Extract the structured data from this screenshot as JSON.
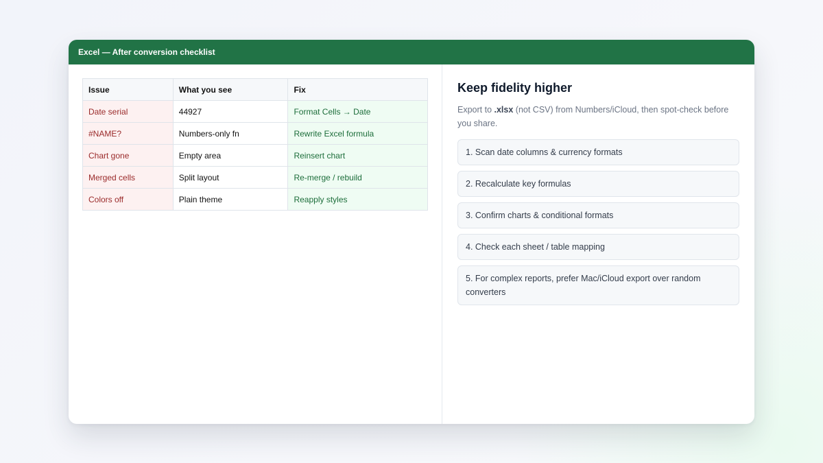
{
  "window": {
    "title": "Excel — After conversion checklist"
  },
  "table": {
    "headers": [
      "Issue",
      "What you see",
      "Fix"
    ],
    "rows": [
      {
        "issue": "Date serial",
        "see": "44927",
        "fix": "Format Cells → Date"
      },
      {
        "issue": "#NAME?",
        "see": "Numbers-only fn",
        "fix": "Rewrite Excel formula"
      },
      {
        "issue": "Chart gone",
        "see": "Empty area",
        "fix": "Reinsert chart"
      },
      {
        "issue": "Merged cells",
        "see": "Split layout",
        "fix": "Re-merge / rebuild"
      },
      {
        "issue": "Colors off",
        "see": "Plain theme",
        "fix": "Reapply styles"
      }
    ]
  },
  "panel": {
    "heading": "Keep fidelity higher",
    "intro_prefix": "Export to ",
    "intro_bold": ".xlsx",
    "intro_suffix": " (not CSV) from Numbers/iCloud, then spot-check before you share.",
    "steps": [
      "1. Scan date columns & currency formats",
      "2. Recalculate key formulas",
      "3. Confirm charts & conditional formats",
      "4. Check each sheet / table mapping",
      "5. For complex reports, prefer Mac/iCloud export over random converters"
    ]
  },
  "colors": {
    "titlebar": "#217346",
    "issue_bg": "#fdf1f1",
    "issue_text": "#9a2a2a",
    "fix_bg": "#effcf3",
    "fix_text": "#1c6d3a"
  }
}
